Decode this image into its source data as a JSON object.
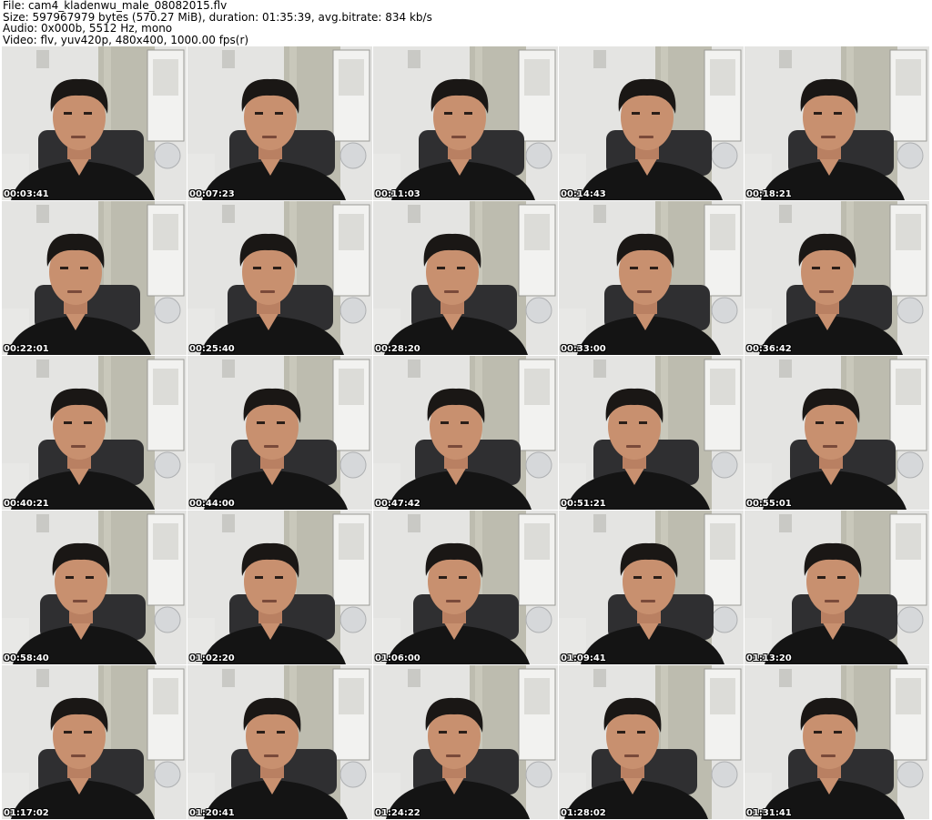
{
  "header": {
    "line1": "File: cam4_kladenwu_male_08082015.flv",
    "line2": "Size: 597967979 bytes (570.27 MiB), duration: 01:35:39, avg.bitrate: 834 kb/s",
    "line3": "Audio: 0x000b, 5512 Hz, mono",
    "line4": "Video: flv, yuv420p, 480x400, 1000.00 fps(r)"
  },
  "thumbnails": [
    {
      "timestamp": "00:03:41"
    },
    {
      "timestamp": "00:07:23"
    },
    {
      "timestamp": "00:11:03"
    },
    {
      "timestamp": "00:14:43"
    },
    {
      "timestamp": "00:18:21"
    },
    {
      "timestamp": "00:22:01"
    },
    {
      "timestamp": "00:25:40"
    },
    {
      "timestamp": "00:28:20"
    },
    {
      "timestamp": "00:33:00"
    },
    {
      "timestamp": "00:36:42"
    },
    {
      "timestamp": "00:40:21"
    },
    {
      "timestamp": "00:44:00"
    },
    {
      "timestamp": "00:47:42"
    },
    {
      "timestamp": "00:51:21"
    },
    {
      "timestamp": "00:55:01"
    },
    {
      "timestamp": "00:58:40"
    },
    {
      "timestamp": "01:02:20"
    },
    {
      "timestamp": "01:06:00"
    },
    {
      "timestamp": "01:09:41"
    },
    {
      "timestamp": "01:13:20"
    },
    {
      "timestamp": "01:17:02"
    },
    {
      "timestamp": "01:20:41"
    },
    {
      "timestamp": "01:24:22"
    },
    {
      "timestamp": "01:28:02"
    },
    {
      "timestamp": "01:31:41"
    }
  ],
  "colors": {
    "wall": "#e4e4e2",
    "plaster": "#bdbcaf",
    "shirt": "#141414",
    "skin": "#c8906f",
    "hair": "#1a1715",
    "chair": "#2f2f31"
  }
}
